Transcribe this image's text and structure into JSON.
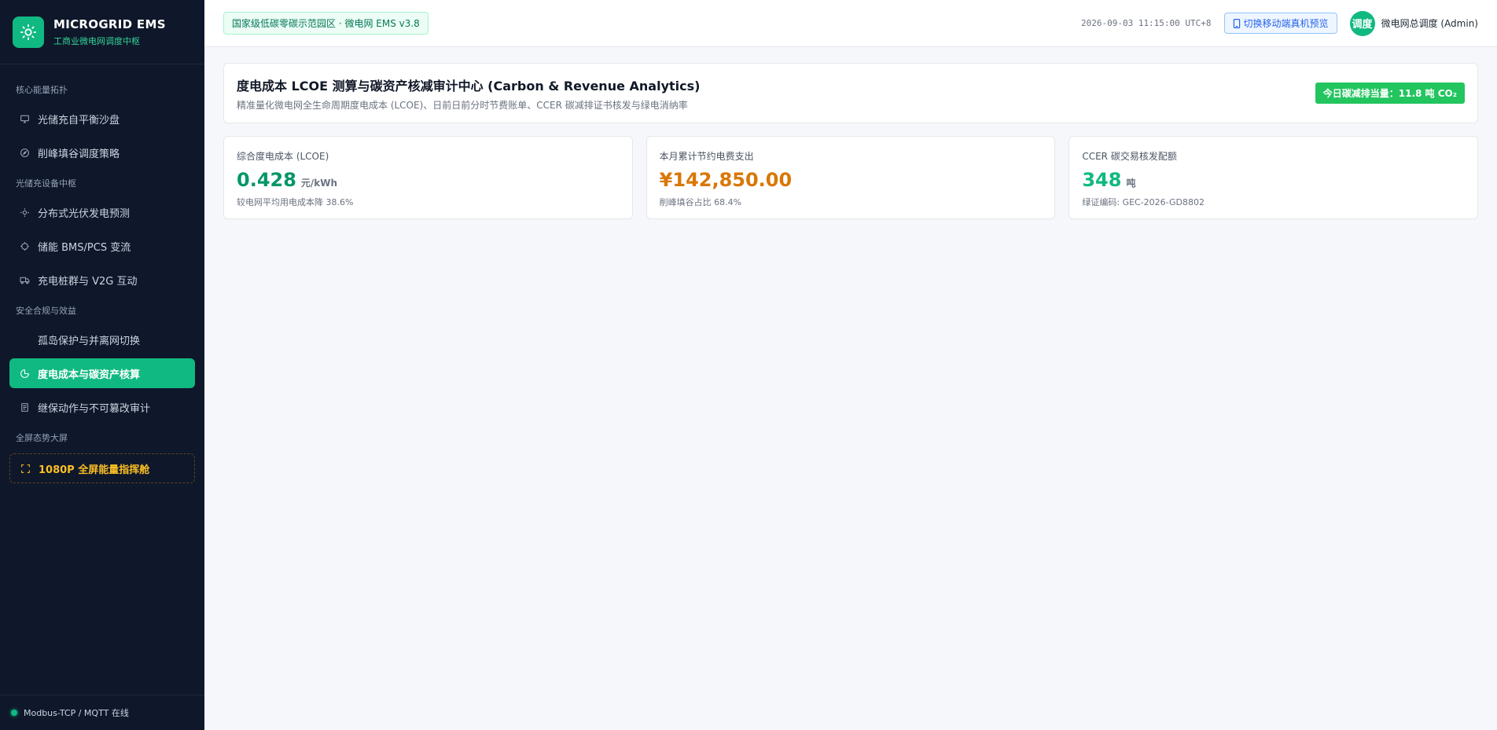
{
  "colors": {
    "accent": "#10b981",
    "sidebar_bg": "#0f172a",
    "lcoe_value": "#059669",
    "saving_value": "#d97706",
    "ccer_value": "#10b981",
    "special": "#fbbf24"
  },
  "brand": {
    "icon": "sun-icon",
    "title": "MICROGRID EMS",
    "subtitle": "工商业微电网调度中枢"
  },
  "sidebar": {
    "groups": [
      {
        "label": "核心能量拓扑",
        "items": [
          {
            "label": "光储充自平衡沙盘",
            "icon": "monitor-icon",
            "active": false
          },
          {
            "label": "削峰填谷调度策略",
            "icon": "compass-icon",
            "active": false
          }
        ]
      },
      {
        "label": "光储充设备中枢",
        "items": [
          {
            "label": "分布式光伏发电预测",
            "icon": "sun-icon",
            "active": false
          },
          {
            "label": "储能 BMS/PCS 变流",
            "icon": "chip-icon",
            "active": false
          },
          {
            "label": "充电桩群与 V2G 互动",
            "icon": "truck-icon",
            "active": false
          }
        ]
      },
      {
        "label": "安全合规与效益",
        "items": [
          {
            "label": "孤岛保护与并离网切换",
            "icon": "",
            "active": false
          },
          {
            "label": "度电成本与碳资产核算",
            "icon": "pie-chart-icon",
            "active": true
          },
          {
            "label": "继保动作与不可篡改审计",
            "icon": "document-icon",
            "active": false
          }
        ]
      },
      {
        "label": "全屏态势大屏",
        "items": [
          {
            "label": "1080P 全屏能量指挥舱",
            "icon": "fullscreen-icon",
            "active": false,
            "special": true
          }
        ]
      }
    ],
    "footer": "Modbus-TCP / MQTT 在线"
  },
  "header": {
    "tag": "国家级低碳零碳示范园区 · 微电网 EMS v3.8",
    "timestamp": "2026-09-03 11:15:00 UTC+8",
    "mobile_button": "切换移动端真机预览",
    "avatar": "调度",
    "user": "微电网总调度 (Admin)"
  },
  "page": {
    "title": "度电成本 LCOE 测算与碳资产核减审计中心 (Carbon & Revenue Analytics)",
    "subtitle": "精准量化微电网全生命周期度电成本 (LCOE)、日前日前分时节费账单、CCER 碳减排证书核发与绿电消纳率",
    "badge": "今日碳减排当量：11.8 吨 CO₂"
  },
  "kpis": [
    {
      "label": "综合度电成本 (LCOE)",
      "value": "0.428",
      "unit": "元/kWh",
      "note": "较电网平均用电成本降 38.6%"
    },
    {
      "label": "本月累计节约电费支出",
      "value": "¥142,850.00",
      "unit": "",
      "note": "削峰填谷占比 68.4%"
    },
    {
      "label": "CCER 碳交易核发配额",
      "value": "348",
      "unit": "吨",
      "note": "绿证编码: GEC-2026-GD8802"
    }
  ]
}
